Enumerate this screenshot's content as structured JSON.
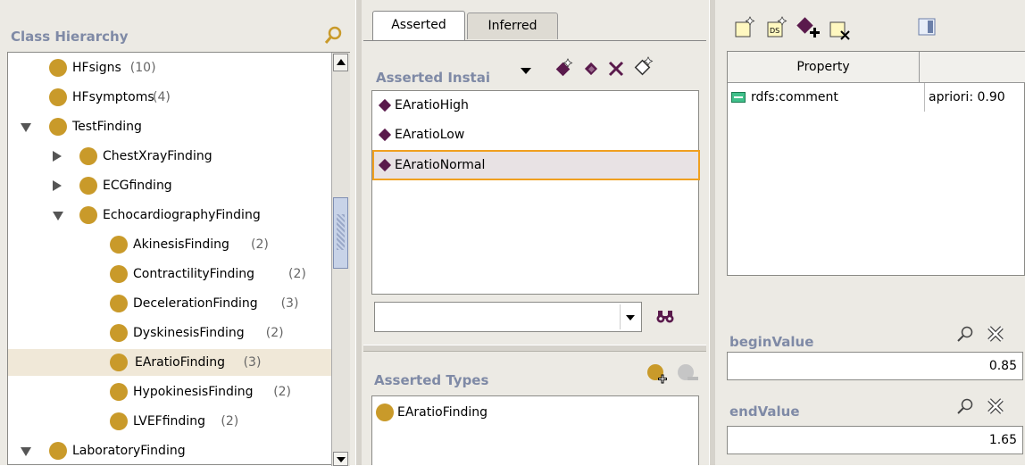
{
  "class_hierarchy": {
    "title": "Class Hierarchy",
    "items": [
      {
        "label": "HFsigns",
        "count": "(10)",
        "depth": 1,
        "toggle": "none"
      },
      {
        "label": "HFsymptoms",
        "count": "(4)",
        "depth": 1,
        "toggle": "none"
      },
      {
        "label": "TestFinding",
        "count": "",
        "depth": 0,
        "toggle": "expanded"
      },
      {
        "label": "ChestXrayFinding",
        "count": "",
        "depth": 1,
        "toggle": "collapsed"
      },
      {
        "label": "ECGfinding",
        "count": "",
        "depth": 1,
        "toggle": "collapsed"
      },
      {
        "label": "EchocardiographyFinding",
        "count": "",
        "depth": 1,
        "toggle": "expanded"
      },
      {
        "label": "AkinesisFinding",
        "count": "(2)",
        "depth": 2,
        "toggle": "none"
      },
      {
        "label": "ContractilityFinding",
        "count": "(2)",
        "depth": 2,
        "toggle": "none"
      },
      {
        "label": "DecelerationFinding",
        "count": "(3)",
        "depth": 2,
        "toggle": "none"
      },
      {
        "label": "DyskinesisFinding",
        "count": "(2)",
        "depth": 2,
        "toggle": "none"
      },
      {
        "label": "EAratioFinding",
        "count": "(3)",
        "depth": 2,
        "toggle": "none",
        "selected": true
      },
      {
        "label": "HypokinesisFinding",
        "count": "(2)",
        "depth": 2,
        "toggle": "none"
      },
      {
        "label": "LVEFfinding",
        "count": "(2)",
        "depth": 2,
        "toggle": "none"
      },
      {
        "label": "LaboratoryFinding",
        "count": "",
        "depth": 0,
        "toggle": "expanded"
      }
    ]
  },
  "tabs": {
    "asserted": "Asserted",
    "inferred": "Inferred"
  },
  "instances": {
    "title": "Asserted Instai",
    "items": [
      "EAratioHigh",
      "EAratioLow",
      "EAratioNormal"
    ],
    "selected": "EAratioNormal",
    "combo_value": ""
  },
  "asserted_types": {
    "title": "Asserted Types",
    "items": [
      "EAratioFinding"
    ]
  },
  "properties": {
    "col_property": "Property",
    "col_value": "",
    "rows": [
      {
        "property": "rdfs:comment",
        "value": "apriori: 0.90"
      }
    ]
  },
  "begin_value": {
    "label": "beginValue",
    "value": "0.85"
  },
  "end_value": {
    "label": "endValue",
    "value": "1.65"
  },
  "colors": {
    "class_icon": "#c99a2a",
    "instance_icon": "#5a1a4c",
    "selection": "#f0e8d8",
    "panel_bg": "#eceae4"
  }
}
